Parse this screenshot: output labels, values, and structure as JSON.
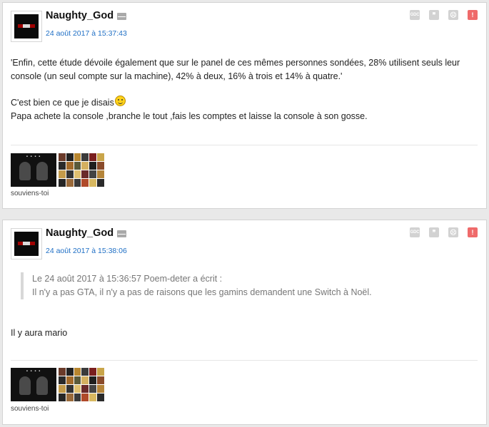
{
  "posts": [
    {
      "author": "Naughty_God",
      "date": "24 août 2017 à 15:37:43",
      "paragraphs": [
        "'Enfin, cette étude dévoile également que sur le panel de ces mêmes personnes sondées, 28% utilisent seuls leur console (un seul compte sur la machine), 42% à deux, 16% à trois et 14% à quatre.'",
        "C'est bien ce que je disais",
        "Papa achete la console ,branche le tout ,fais les comptes et laisse la console à son gosse."
      ],
      "signature": "souviens-toi"
    },
    {
      "author": "Naughty_God",
      "date": "24 août 2017 à 15:38:06",
      "quote": {
        "header": "Le 24 août 2017 à 15:36:57 Poem-deter a écrit :",
        "text": "Il n'y a pas GTA, il n'y a pas de raisons que les gamins demandent une Switch à Noël."
      },
      "paragraphs": [
        "Il y aura mario"
      ],
      "signature": "souviens-toi"
    }
  ],
  "tools": {
    "gdc_label": "GDC",
    "quote_glyph": "❞",
    "sad_glyph": "☹",
    "alert_glyph": "!"
  },
  "icons": [
    "mail-icon",
    "gdc-icon",
    "quote-icon",
    "sad-face-icon",
    "alert-icon",
    "smiley-icon"
  ],
  "colors": {
    "date_link": "#1f6fc5",
    "alert": "#ef6a6a",
    "tool_grey": "#d2d2d2",
    "quote_text": "#777777"
  }
}
